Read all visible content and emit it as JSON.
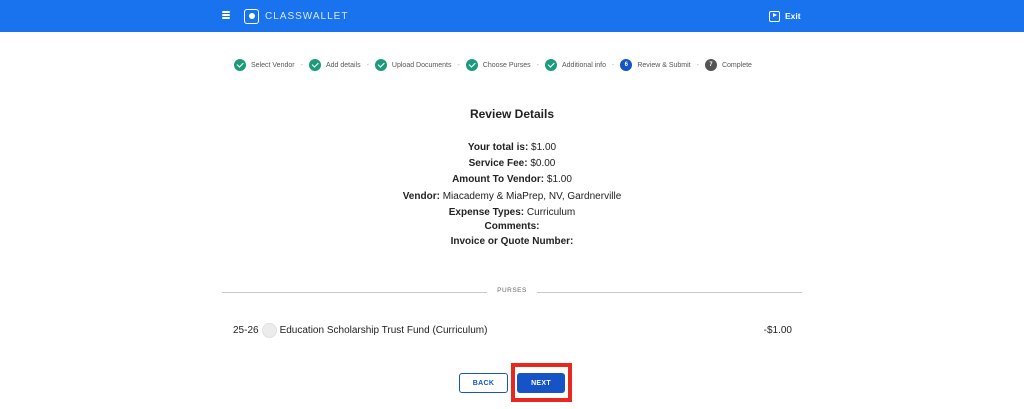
{
  "header": {
    "brand": "CLASSWALLET",
    "exit_label": "Exit"
  },
  "stepper": {
    "steps": [
      {
        "label": "Select Vendor",
        "state": "done"
      },
      {
        "label": "Add details",
        "state": "done"
      },
      {
        "label": "Upload Documents",
        "state": "done"
      },
      {
        "label": "Choose Purses",
        "state": "done"
      },
      {
        "label": "Additional info",
        "state": "done"
      },
      {
        "label": "Review & Submit",
        "state": "current",
        "number": "6"
      },
      {
        "label": "Complete",
        "state": "todo",
        "number": "7"
      }
    ],
    "separator": "-"
  },
  "review": {
    "title": "Review Details",
    "details": [
      {
        "label": "Your total is:",
        "value": " $1.00"
      },
      {
        "label": "Service Fee:",
        "value": " $0.00"
      },
      {
        "label": "Amount To Vendor:",
        "value": " $1.00"
      },
      {
        "label": "Vendor:",
        "value": " Miacademy & MiaPrep, NV, Gardnerville"
      },
      {
        "label": "Expense Types:",
        "value": " Curriculum"
      },
      {
        "label": "Comments:",
        "value": ""
      },
      {
        "label": "Invoice or Quote Number:",
        "value": ""
      }
    ]
  },
  "purses": {
    "section_label": "PURSES",
    "items": [
      {
        "prefix": "25-26",
        "name": "Education Scholarship Trust Fund (Curriculum)",
        "amount": "-$1.00"
      }
    ]
  },
  "actions": {
    "back_label": "BACK",
    "next_label": "NEXT"
  },
  "colors": {
    "header_bg": "#1a73ee",
    "step_done": "#1d9a7c",
    "step_current": "#1553c7",
    "step_todo": "#555555",
    "primary": "#1553c7",
    "highlight": "#e8271e"
  },
  "icons": {
    "menu": "hamburger-icon",
    "logo": "classwallet-logo-icon",
    "exit": "exit-icon",
    "step_done": "check-icon"
  }
}
